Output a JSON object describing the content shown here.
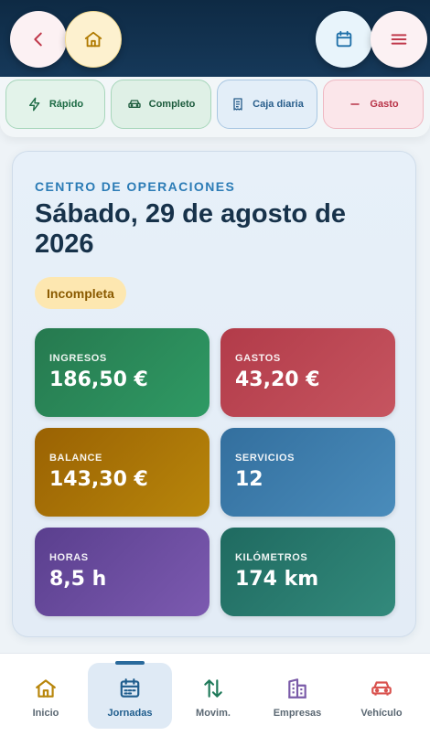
{
  "header": {
    "back_icon": "chevron-left-icon",
    "home_icon": "home-icon",
    "calendar_icon": "calendar-icon",
    "menu_icon": "menu-icon"
  },
  "quick_actions": [
    {
      "label": "Rápido",
      "icon": "bolt-icon"
    },
    {
      "label": "Completo",
      "icon": "car-icon"
    },
    {
      "label": "Caja diaria",
      "icon": "receipt-icon"
    },
    {
      "label": "Gasto",
      "icon": "minus-icon"
    }
  ],
  "main": {
    "eyebrow": "CENTRO DE OPERACIONES",
    "title": "Sábado, 29 de agosto de 2026",
    "status": "Incompleta",
    "stats": [
      {
        "label": "INGRESOS",
        "value": "186,50 €",
        "color": "#2b8a5a"
      },
      {
        "label": "GASTOS",
        "value": "43,20 €",
        "color": "#bd4855"
      },
      {
        "label": "BALANCE",
        "value": "143,30 €",
        "color": "#a97405"
      },
      {
        "label": "SERVICIOS",
        "value": "12",
        "color": "#3e80b0"
      },
      {
        "label": "HORAS",
        "value": "8,5 h",
        "color": "#6b4ca0"
      },
      {
        "label": "KILÓMETROS",
        "value": "174 km",
        "color": "#2a7d70"
      }
    ]
  },
  "bottom_nav": {
    "active": "Jornadas",
    "items": [
      {
        "label": "Inicio",
        "icon": "home-icon",
        "color": "#b8860b"
      },
      {
        "label": "Jornadas",
        "icon": "calendar-icon",
        "color": "#1f5d8d"
      },
      {
        "label": "Movim.",
        "icon": "arrows-updown-icon",
        "color": "#1f7a5a"
      },
      {
        "label": "Empresas",
        "icon": "building-icon",
        "color": "#7a5aa8"
      },
      {
        "label": "Vehículo",
        "icon": "car-icon",
        "color": "#d9534f"
      }
    ]
  }
}
